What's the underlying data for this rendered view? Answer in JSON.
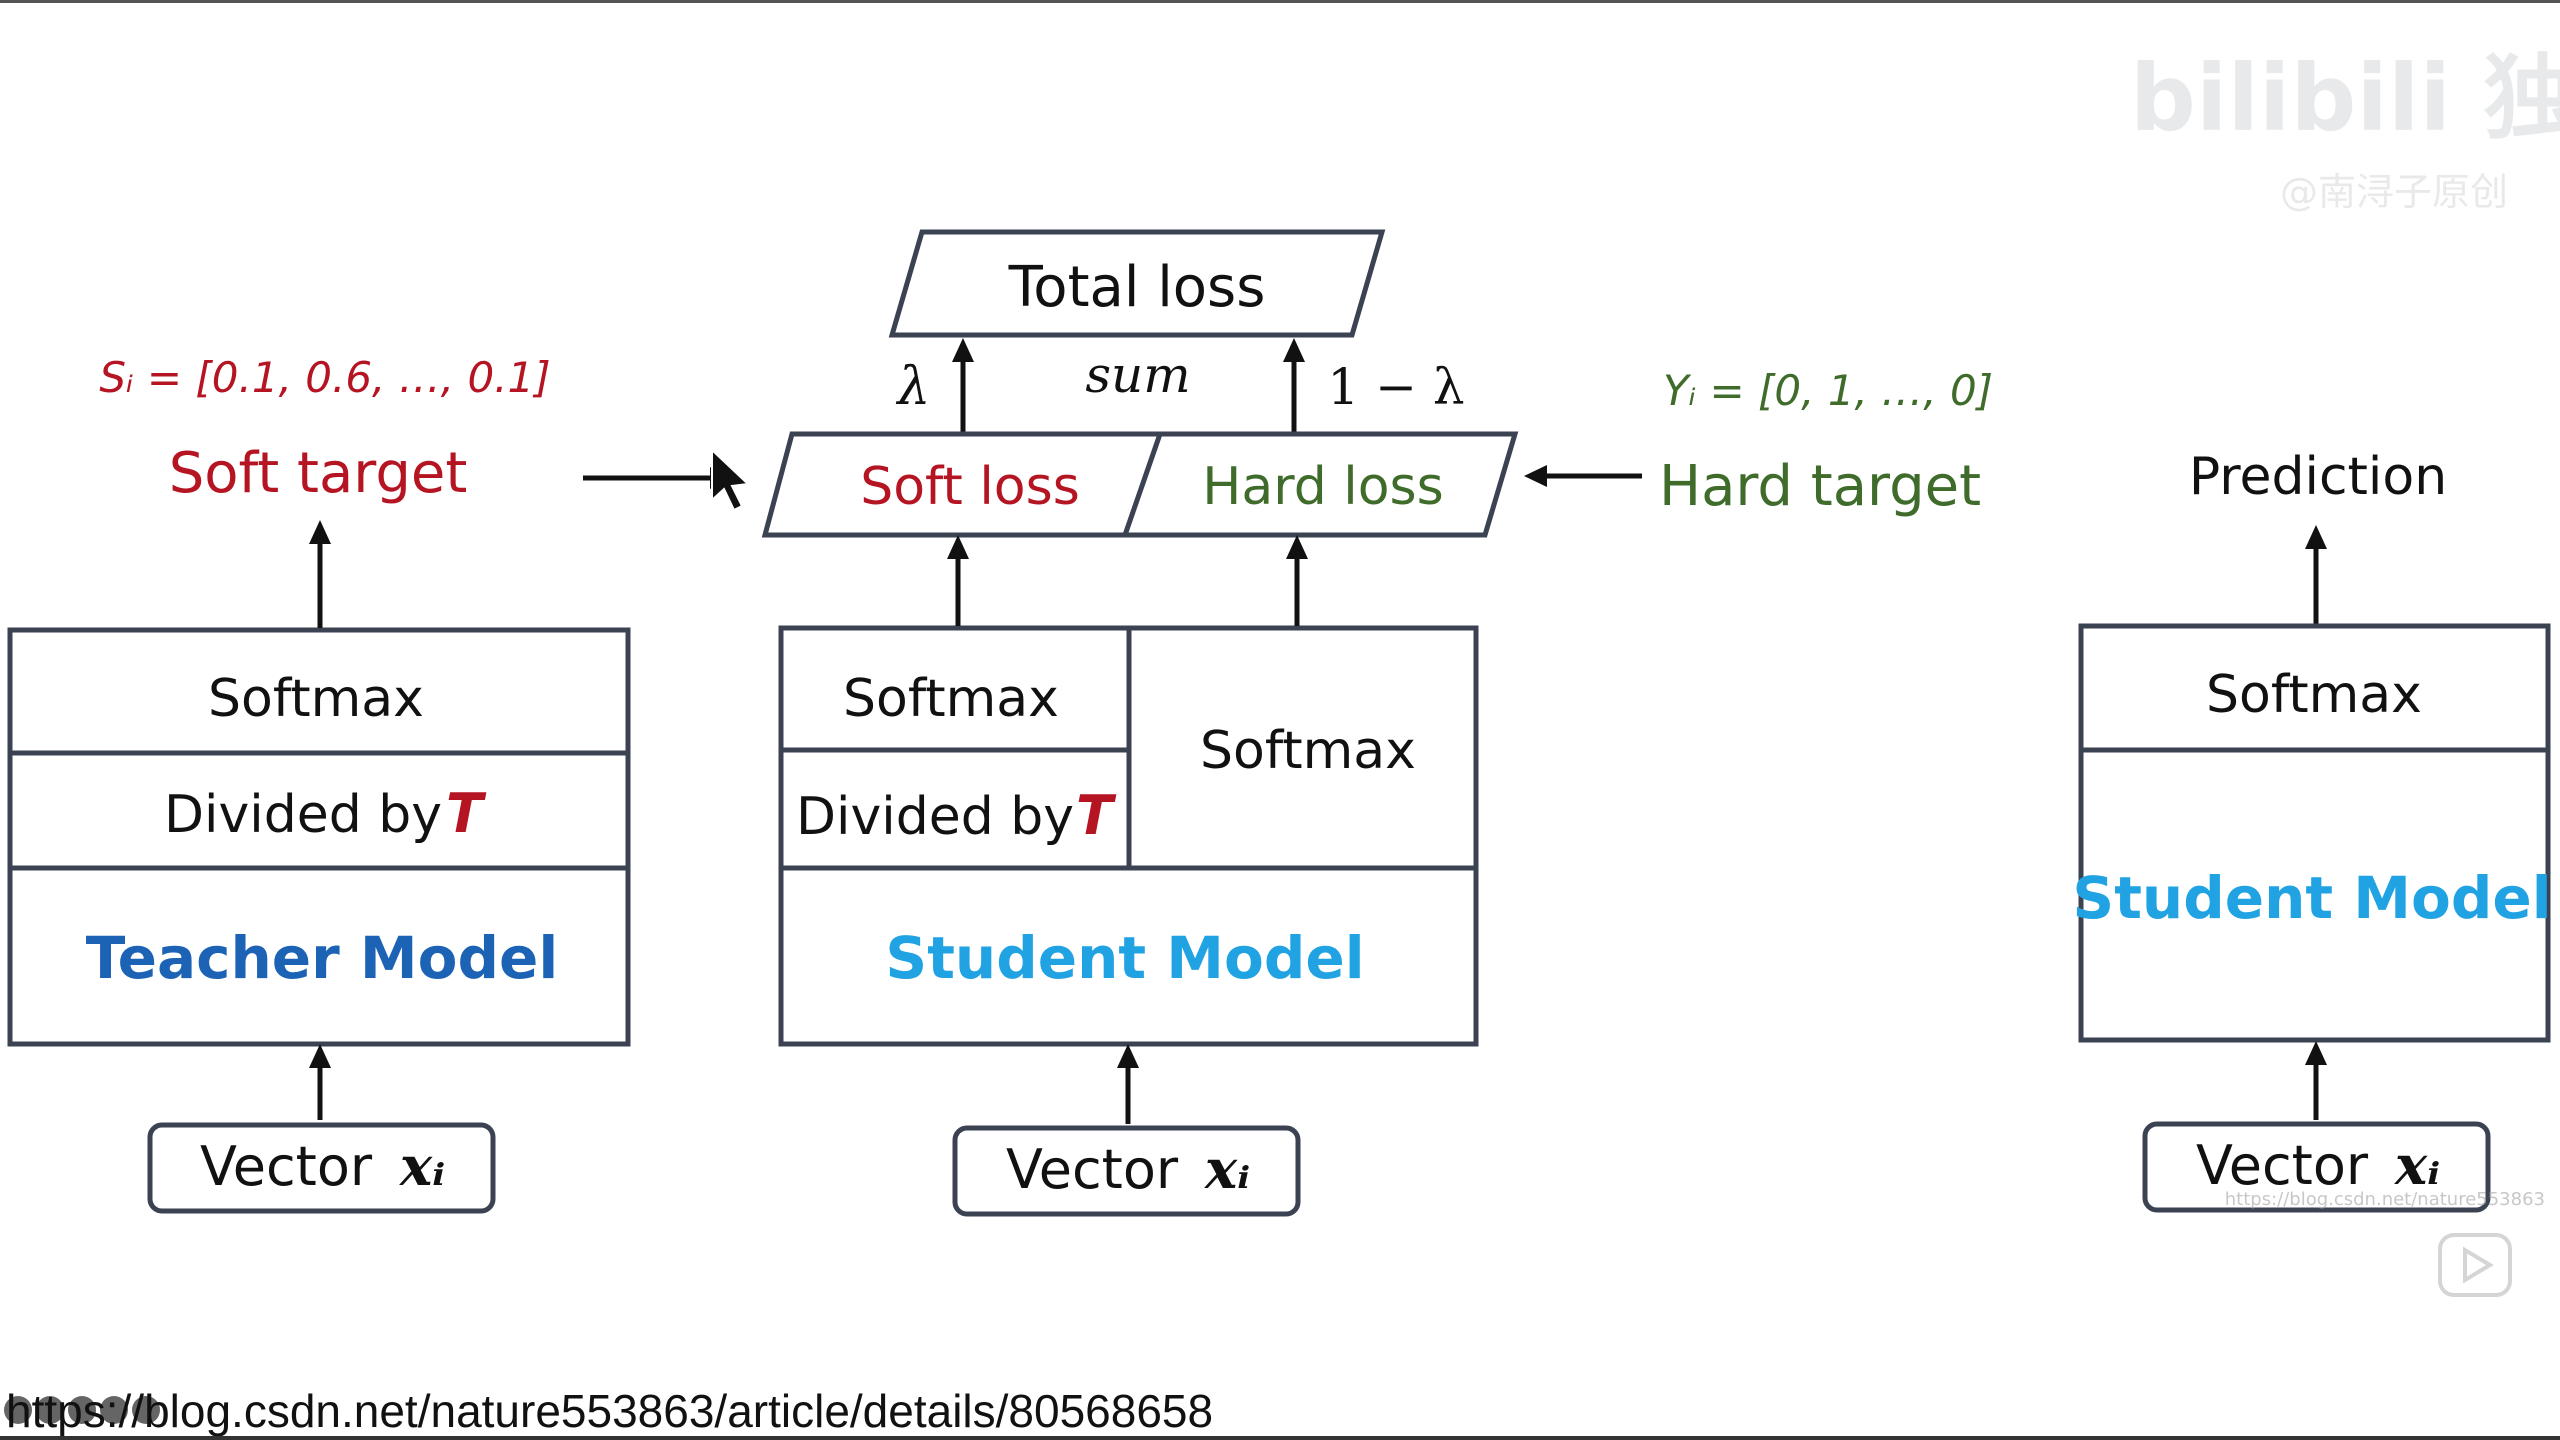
{
  "watermark": {
    "logo_text": "bilibili 独家",
    "sub_text": "@南浔子原创",
    "csdn_text": "https://blog.csdn.net/nature553863"
  },
  "url": "https://blog.csdn.net/nature553863/article/details/80568658",
  "total_loss": "Total loss",
  "sum_label": "sum",
  "lambda_label": "λ",
  "one_minus_lambda_label": "1 − λ",
  "soft_loss": "Soft loss",
  "hard_loss": "Hard loss",
  "soft_target": {
    "formula": "Sᵢ = [0.1, 0.6, …, 0.1]",
    "label": "Soft target"
  },
  "hard_target": {
    "formula": "Yᵢ = [0, 1, …, 0]",
    "label": "Hard target"
  },
  "teacher": {
    "softmax": "Softmax",
    "divided_by": "Divided by",
    "T": "T",
    "model": "Teacher Model",
    "vector": "Vector",
    "xi": "xᵢ"
  },
  "student": {
    "softmax_left": "Softmax",
    "softmax_right": "Softmax",
    "divided_by": "Divided by",
    "T": "T",
    "model": "Student Model",
    "vector": "Vector",
    "xi": "xᵢ"
  },
  "student_pred": {
    "prediction": "Prediction",
    "softmax": "Softmax",
    "model": "Student Model",
    "vector": "Vector",
    "xi": "xᵢ"
  },
  "colors": {
    "red": "#b51522",
    "green": "#3f6b2b",
    "teacher_blue": "#1d63b5",
    "student_blue": "#21a3e3"
  }
}
